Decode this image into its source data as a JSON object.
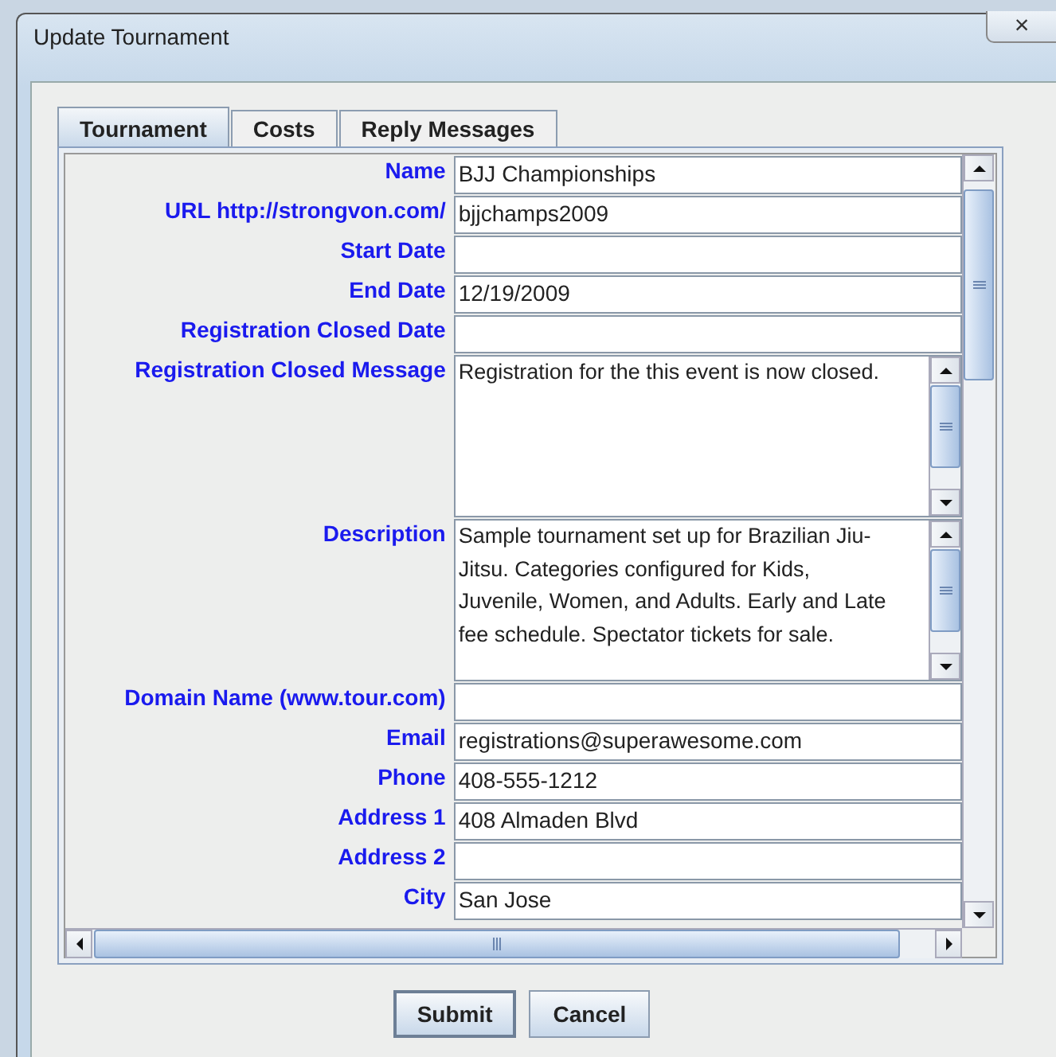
{
  "window": {
    "title": "Update Tournament",
    "close": "×"
  },
  "tabs": [
    {
      "label": "Tournament",
      "selected": true
    },
    {
      "label": "Costs",
      "selected": false
    },
    {
      "label": "Reply Messages",
      "selected": false
    }
  ],
  "fields": [
    {
      "kind": "text",
      "label": "Name",
      "value": "BJJ Championships"
    },
    {
      "kind": "text",
      "label": "URL http://strongvon.com/",
      "value": "bjjchamps2009"
    },
    {
      "kind": "text",
      "label": "Start Date"
    },
    {
      "kind": "text",
      "label": "End Date",
      "value": "12/19/2009"
    },
    {
      "kind": "text",
      "label": "Registration Closed Date"
    },
    {
      "kind": "textarea",
      "label": "Registration Closed Message",
      "value": "Registration for the this event is now closed."
    },
    {
      "kind": "textarea",
      "label": "Description",
      "value": "Sample tournament set up for Brazilian Jiu-Jitsu. Categories configured for Kids, Juvenile, Women, and Adults. Early and Late fee schedule. Spectator tickets for sale."
    },
    {
      "kind": "text",
      "label": "Domain Name (www.tour.com)"
    },
    {
      "kind": "text",
      "label": "Email",
      "value": "registrations@superawesome.com"
    },
    {
      "kind": "text",
      "label": "Phone",
      "value": "408-555-1212"
    },
    {
      "kind": "text",
      "label": "Address 1",
      "value": "408 Almaden Blvd"
    },
    {
      "kind": "text",
      "label": "Address 2"
    },
    {
      "kind": "text",
      "label": "City",
      "value": "San Jose"
    }
  ],
  "buttons": [
    {
      "label": "Submit",
      "focused": true
    },
    {
      "label": "Cancel",
      "focused": false
    }
  ]
}
